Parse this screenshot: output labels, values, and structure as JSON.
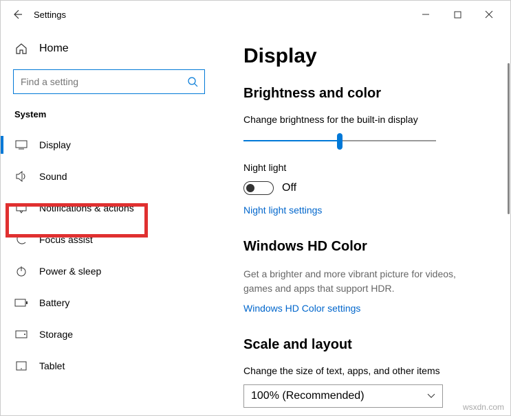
{
  "titlebar": {
    "title": "Settings"
  },
  "sidebar": {
    "home": "Home",
    "search_placeholder": "Find a setting",
    "section": "System",
    "items": [
      {
        "label": "Display"
      },
      {
        "label": "Sound"
      },
      {
        "label": "Notifications & actions"
      },
      {
        "label": "Focus assist"
      },
      {
        "label": "Power & sleep"
      },
      {
        "label": "Battery"
      },
      {
        "label": "Storage"
      },
      {
        "label": "Tablet"
      }
    ]
  },
  "main": {
    "page_title": "Display",
    "brightness": {
      "header": "Brightness and color",
      "label": "Change brightness for the built-in display",
      "nightlight_label": "Night light",
      "nightlight_state": "Off",
      "nightlight_link": "Night light settings"
    },
    "hdcolor": {
      "header": "Windows HD Color",
      "desc": "Get a brighter and more vibrant picture for videos, games and apps that support HDR.",
      "link": "Windows HD Color settings"
    },
    "scale": {
      "header": "Scale and layout",
      "label": "Change the size of text, apps, and other items",
      "value": "100% (Recommended)"
    }
  },
  "watermark": "wsxdn.com"
}
